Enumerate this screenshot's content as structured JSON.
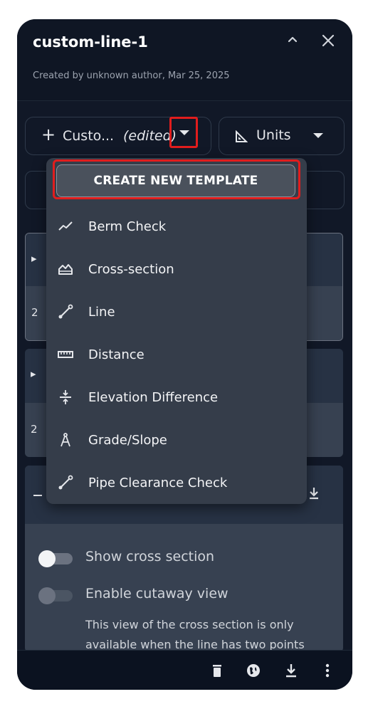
{
  "header": {
    "title": "custom-line-1",
    "subtitle": "Created by unknown author, Mar 25, 2025"
  },
  "template_selector": {
    "prefix": "+",
    "name": "Custo...",
    "edited": "(edited)"
  },
  "units_button": {
    "label": "Units"
  },
  "dropdown": {
    "create_label": "CREATE NEW TEMPLATE",
    "items": [
      {
        "label": "Berm Check",
        "icon": "trend-line-icon"
      },
      {
        "label": "Cross-section",
        "icon": "cross-section-icon"
      },
      {
        "label": "Line",
        "icon": "line-segment-icon"
      },
      {
        "label": "Distance",
        "icon": "ruler-icon"
      },
      {
        "label": "Elevation Difference",
        "icon": "elevation-difference-icon"
      },
      {
        "label": "Grade/Slope",
        "icon": "compass-icon"
      },
      {
        "label": "Pipe Clearance Check",
        "icon": "line-segment-icon"
      }
    ]
  },
  "cards": {
    "card1_fragment": "2",
    "card2_fragment": "2"
  },
  "settings": {
    "show_cross_section": {
      "label": "Show cross section",
      "enabled": false
    },
    "enable_cutaway": {
      "label": "Enable cutaway view",
      "enabled": false
    },
    "cutaway_description": "This view of the cross section is only available when the line has two points"
  },
  "colors": {
    "panel_bg": "#111827",
    "highlight": "#e11d1d",
    "dropdown_bg": "#353d4a"
  }
}
